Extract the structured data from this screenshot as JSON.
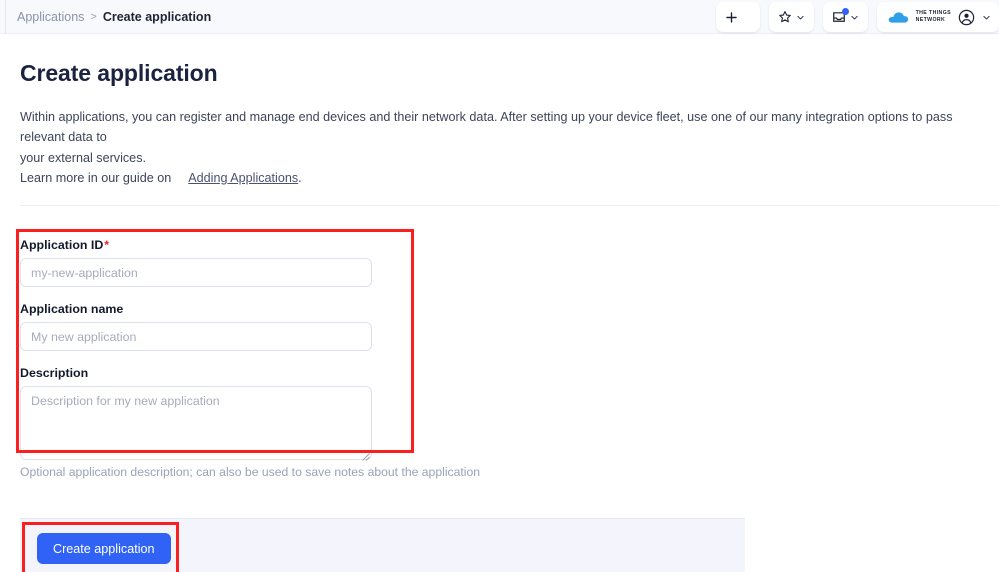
{
  "header": {
    "breadcrumb": {
      "parent": "Applications",
      "separator": ">",
      "current": "Create application"
    },
    "toolbar": {
      "add_icon": "plus-icon",
      "bookmark_icon": "star-icon",
      "inbox_icon": "inbox-icon",
      "chevron_icon": "chevron-down-icon",
      "notification_dot": true,
      "brand": {
        "logo_icon": "cloud-icon",
        "line1": "THE THINGS",
        "line2": "NETWORK",
        "avatar_icon": "user-avatar-icon"
      }
    }
  },
  "main": {
    "title": "Create application",
    "intro_line1": "Within applications, you can register and manage end devices and their network data. After setting up your device fleet, use one of our many integration options to pass relevant data to",
    "intro_line1b": "your external services.",
    "learn_more_prefix": "Learn more in our guide on",
    "learn_more_link": "Adding Applications",
    "learn_more_suffix": ".",
    "book_icon": "book-icon"
  },
  "form": {
    "application_id": {
      "label": "Application ID",
      "required_marker": "*",
      "placeholder": "my-new-application",
      "value": ""
    },
    "application_name": {
      "label": "Application name",
      "placeholder": "My new application",
      "value": ""
    },
    "description": {
      "label": "Description",
      "placeholder": "Description for my new application",
      "value": "",
      "help_text": "Optional application description; can also be used to save notes about the application"
    },
    "submit_label": "Create application"
  },
  "colors": {
    "accent_blue": "#2f62f5",
    "highlight_red": "#fb2020",
    "footer_bg": "#f4f4fd",
    "header_bg": "#f7f9fc"
  }
}
